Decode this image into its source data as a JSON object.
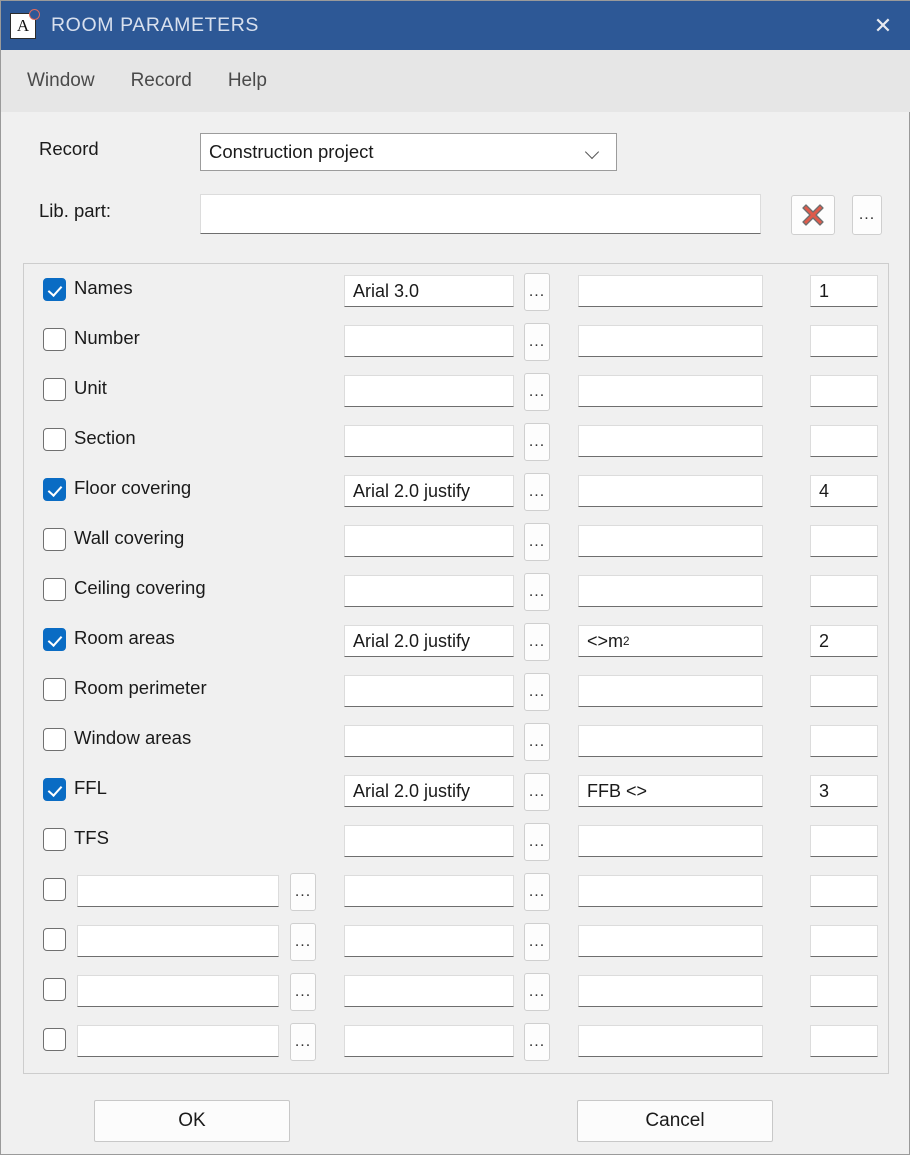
{
  "window": {
    "title": "ROOM PARAMETERS",
    "app_icon_letter": "A",
    "close_label": "✕",
    "titlebar_color": "#2d5896"
  },
  "menubar": {
    "items": [
      {
        "label": "Window"
      },
      {
        "label": "Record"
      },
      {
        "label": "Help"
      }
    ]
  },
  "form": {
    "record_label": "Record",
    "record_value": "Construction project",
    "lib_part_label": "Lib. part:",
    "lib_part_value": "",
    "lib_part_placeholder": "",
    "delete_icon": "red-x-icon",
    "browse_label": "...",
    "accent_checkbox_color": "#0a6cc4",
    "delete_icon_color": "#e05a4a"
  },
  "table": {
    "browse_label": "...",
    "rows": [
      {
        "checked": true,
        "label": "Names",
        "editable_name": false,
        "name_value": "",
        "font": "Arial 3.0",
        "text": "",
        "text_html": "",
        "num": "1"
      },
      {
        "checked": false,
        "label": "Number",
        "editable_name": false,
        "name_value": "",
        "font": "",
        "text": "",
        "text_html": "",
        "num": ""
      },
      {
        "checked": false,
        "label": "Unit",
        "editable_name": false,
        "name_value": "",
        "font": "",
        "text": "",
        "text_html": "",
        "num": ""
      },
      {
        "checked": false,
        "label": "Section",
        "editable_name": false,
        "name_value": "",
        "font": "",
        "text": "",
        "text_html": "",
        "num": ""
      },
      {
        "checked": true,
        "label": "Floor covering",
        "editable_name": false,
        "name_value": "",
        "font": "Arial 2.0 justify",
        "text": "",
        "text_html": "",
        "num": "4"
      },
      {
        "checked": false,
        "label": "Wall covering",
        "editable_name": false,
        "name_value": "",
        "font": "",
        "text": "",
        "text_html": "",
        "num": ""
      },
      {
        "checked": false,
        "label": "Ceiling covering",
        "editable_name": false,
        "name_value": "",
        "font": "",
        "text": "",
        "text_html": "",
        "num": ""
      },
      {
        "checked": true,
        "label": "Room areas",
        "editable_name": false,
        "name_value": "",
        "font": "Arial 2.0 justify",
        "text": "<>m2",
        "text_html": "&lt;&gt;m<sup>2</sup>",
        "num": "2"
      },
      {
        "checked": false,
        "label": "Room perimeter",
        "editable_name": false,
        "name_value": "",
        "font": "",
        "text": "",
        "text_html": "",
        "num": ""
      },
      {
        "checked": false,
        "label": "Window areas",
        "editable_name": false,
        "name_value": "",
        "font": "",
        "text": "",
        "text_html": "",
        "num": ""
      },
      {
        "checked": true,
        "label": "FFL",
        "editable_name": false,
        "name_value": "",
        "font": "Arial 2.0 justify",
        "text": "FFB <>",
        "text_html": "FFB &lt;&gt;",
        "num": "3"
      },
      {
        "checked": false,
        "label": "TFS",
        "editable_name": false,
        "name_value": "",
        "font": "",
        "text": "",
        "text_html": "",
        "num": ""
      },
      {
        "checked": false,
        "label": "",
        "editable_name": true,
        "name_value": "",
        "font": "",
        "text": "",
        "text_html": "",
        "num": ""
      },
      {
        "checked": false,
        "label": "",
        "editable_name": true,
        "name_value": "",
        "font": "",
        "text": "",
        "text_html": "",
        "num": ""
      },
      {
        "checked": false,
        "label": "",
        "editable_name": true,
        "name_value": "",
        "font": "",
        "text": "",
        "text_html": "",
        "num": ""
      },
      {
        "checked": false,
        "label": "",
        "editable_name": true,
        "name_value": "",
        "font": "",
        "text": "",
        "text_html": "",
        "num": ""
      }
    ]
  },
  "footer": {
    "ok_label": "OK",
    "cancel_label": "Cancel"
  }
}
